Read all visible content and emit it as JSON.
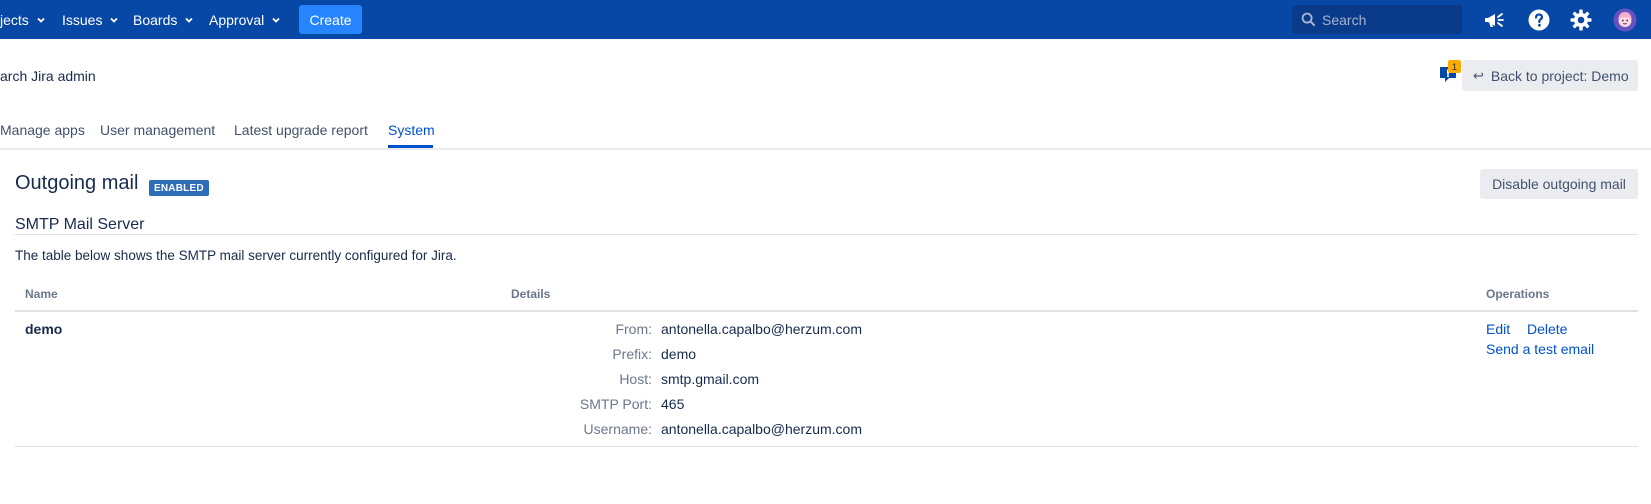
{
  "topnav": {
    "items": [
      {
        "label": "jects"
      },
      {
        "label": "Issues"
      },
      {
        "label": "Boards"
      },
      {
        "label": "Approval"
      }
    ],
    "create_label": "Create",
    "search_placeholder": "Search",
    "icons": [
      "megaphone-icon",
      "help-icon",
      "settings-icon",
      "avatar"
    ],
    "colors": {
      "bar": "#0747a6",
      "create": "#2684ff"
    }
  },
  "header": {
    "admin_search_label": "arch Jira admin",
    "feedback_count": "1",
    "back_button_label": "Back to project: Demo"
  },
  "tabs": [
    {
      "label": "Manage apps",
      "active": false
    },
    {
      "label": "User management",
      "active": false
    },
    {
      "label": "Latest upgrade report",
      "active": false
    },
    {
      "label": "System",
      "active": true
    }
  ],
  "section": {
    "title": "Outgoing mail",
    "status_badge": "ENABLED",
    "disable_button": "Disable outgoing mail",
    "subtitle": "SMTP Mail Server",
    "description": "The table below shows the SMTP mail server currently configured for Jira."
  },
  "table": {
    "headers": {
      "name": "Name",
      "details": "Details",
      "operations": "Operations"
    },
    "rows": [
      {
        "name": "demo",
        "details": [
          {
            "label": "From:",
            "value": "antonella.capalbo@herzum.com"
          },
          {
            "label": "Prefix:",
            "value": "demo"
          },
          {
            "label": "Host:",
            "value": "smtp.gmail.com"
          },
          {
            "label": "SMTP Port:",
            "value": "465"
          },
          {
            "label": "Username:",
            "value": "antonella.capalbo@herzum.com"
          }
        ],
        "operations": {
          "edit": "Edit",
          "delete": "Delete",
          "test": "Send a test email"
        }
      }
    ]
  }
}
